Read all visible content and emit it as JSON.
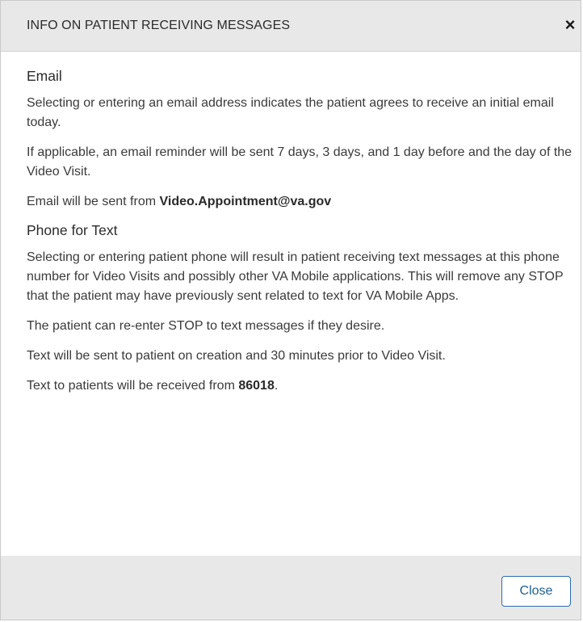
{
  "dialog": {
    "title": "INFO ON PATIENT RECEIVING MESSAGES",
    "close_icon_glyph": "×"
  },
  "email_section": {
    "heading": "Email",
    "para1": "Selecting or entering an email address indicates the patient agrees to receive an initial email today.",
    "para2": "If applicable, an email reminder will be sent 7 days, 3 days, and 1 day before and the day of the Video Visit.",
    "para3_prefix": "Email will be sent from ",
    "sender_address": "Video.Appointment@va.gov"
  },
  "phone_section": {
    "heading": "Phone for Text",
    "para1": "Selecting or entering patient phone will result in patient receiving text messages at this phone number for Video Visits and possibly other VA Mobile applications. This will remove any STOP that the patient may have previously sent related to text for VA Mobile Apps.",
    "para2": "The patient can re-enter STOP to text messages if they desire.",
    "para3": "Text will be sent to patient on creation and 30 minutes prior to Video Visit.",
    "para4_prefix": "Text to patients will be received from ",
    "short_code": "86018",
    "para4_suffix": "."
  },
  "footer": {
    "close_label": "Close"
  },
  "colors": {
    "header_bg": "#e8e8e8",
    "button_border": "#2b6cb0",
    "button_text": "#1d5f98"
  }
}
